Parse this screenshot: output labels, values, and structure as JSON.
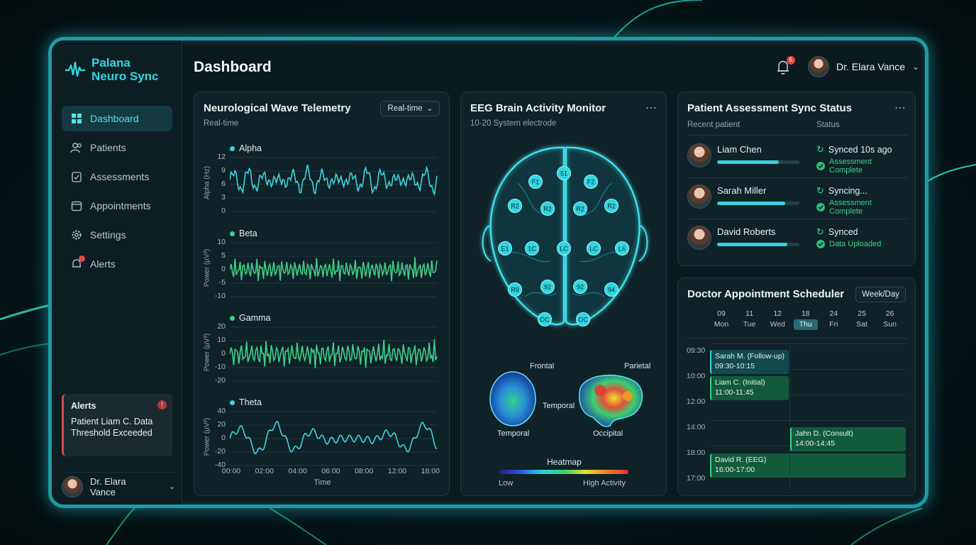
{
  "app": {
    "name_line1": "Palana",
    "name_line2": "Neuro Sync"
  },
  "sidebar": {
    "items": [
      {
        "label": "Dashboard",
        "icon": "dashboard-icon",
        "active": true
      },
      {
        "label": "Patients",
        "icon": "users-icon"
      },
      {
        "label": "Assessments",
        "icon": "clipboard-icon"
      },
      {
        "label": "Appointments",
        "icon": "calendar-icon"
      },
      {
        "label": "Settings",
        "icon": "gear-icon"
      },
      {
        "label": "Alerts",
        "icon": "bell-icon"
      }
    ],
    "alert": {
      "title": "Alerts",
      "count": "!",
      "message": "Patient Liam C. Data Threshold Exceeded"
    },
    "user": "Dr. Elara Vance"
  },
  "header": {
    "title": "Dashboard",
    "notifications": "5",
    "user": "Dr. Elara Vance"
  },
  "telemetry": {
    "title": "Neurological Wave Telemetry",
    "subtitle": "Real-time",
    "select": "Real-time",
    "waves": [
      {
        "name": "Alpha",
        "ylabel": "Alpha (Hz)",
        "ticks": [
          "12",
          "9",
          "6",
          "3",
          "0"
        ],
        "color": "#3fd3de"
      },
      {
        "name": "Beta",
        "ylabel": "Power (µV²)",
        "ticks": [
          "10",
          "5",
          "0",
          "-5",
          "-10"
        ],
        "color": "#3fcf88"
      },
      {
        "name": "Gamma",
        "ylabel": "Power (µV²)",
        "ticks": [
          "20",
          "10",
          "0",
          "-10",
          "-20"
        ],
        "color": "#3fcf88"
      },
      {
        "name": "Theta",
        "ylabel": "Power (µV²)",
        "ticks": [
          "40",
          "20",
          "0",
          "-20",
          "-40"
        ],
        "color": "#3fd3de"
      }
    ],
    "xticks": [
      "00:00",
      "02:00",
      "04:00",
      "06:00",
      "08:00",
      "12:00",
      "18:00"
    ],
    "xlabel": "Time"
  },
  "eeg": {
    "title": "EEG Brain Activity Monitor",
    "subtitle": "10-20 System electrode",
    "electrodes": [
      "51",
      "F1",
      "F2",
      "R2",
      "R2",
      "R2",
      "R2",
      "E1",
      "1C",
      "LC",
      "LC",
      "L6",
      "R9",
      "92",
      "92",
      "94",
      "OC",
      "OC"
    ],
    "labels": {
      "frontal": "Frontal",
      "parietal": "Parietal",
      "temporal_right": "Temporal",
      "temporal_left": "Temporal",
      "occipital": "Occipital"
    },
    "heatmap": {
      "title": "Heatmap",
      "low": "Low",
      "high": "High Activity"
    }
  },
  "sync": {
    "title": "Patient Assessment Sync Status",
    "col_patient": "Recent patient",
    "col_status": "Status",
    "rows": [
      {
        "name": "Liam Chen",
        "progress": 0.75,
        "status": "Synced 10s ago",
        "sub": "Assessment Complete"
      },
      {
        "name": "Sarah Miller",
        "progress": 0.83,
        "status": "Syncing...",
        "sub": "Assessment Complete"
      },
      {
        "name": "David Roberts",
        "progress": 0.85,
        "status": "Synced",
        "sub": "Data Uploaded"
      }
    ]
  },
  "scheduler": {
    "title": "Doctor Appointment Scheduler",
    "view": "Week/Day",
    "days": [
      {
        "num": "09",
        "name": "Mon"
      },
      {
        "num": "11",
        "name": "Tue"
      },
      {
        "num": "12",
        "name": "Wed"
      },
      {
        "num": "18",
        "name": "Thu",
        "active": true
      },
      {
        "num": "24",
        "name": "Fri"
      },
      {
        "num": "25",
        "name": "Sat"
      },
      {
        "num": "26",
        "name": "Sun"
      }
    ],
    "times": [
      "09:30",
      "10:00",
      "12:00",
      "14:00",
      "18:00",
      "17:00"
    ],
    "appointments": [
      {
        "title": "Sarah M. (Follow-up)",
        "time": "09:30-10:15"
      },
      {
        "title": "Liam C. (Initial)",
        "time": "11:00-11:45"
      },
      {
        "title": "Jahn D. (Consult)",
        "time": "14:00-14:45"
      },
      {
        "title": "David R. (EEG)",
        "time": "16:00-17:00"
      }
    ]
  }
}
